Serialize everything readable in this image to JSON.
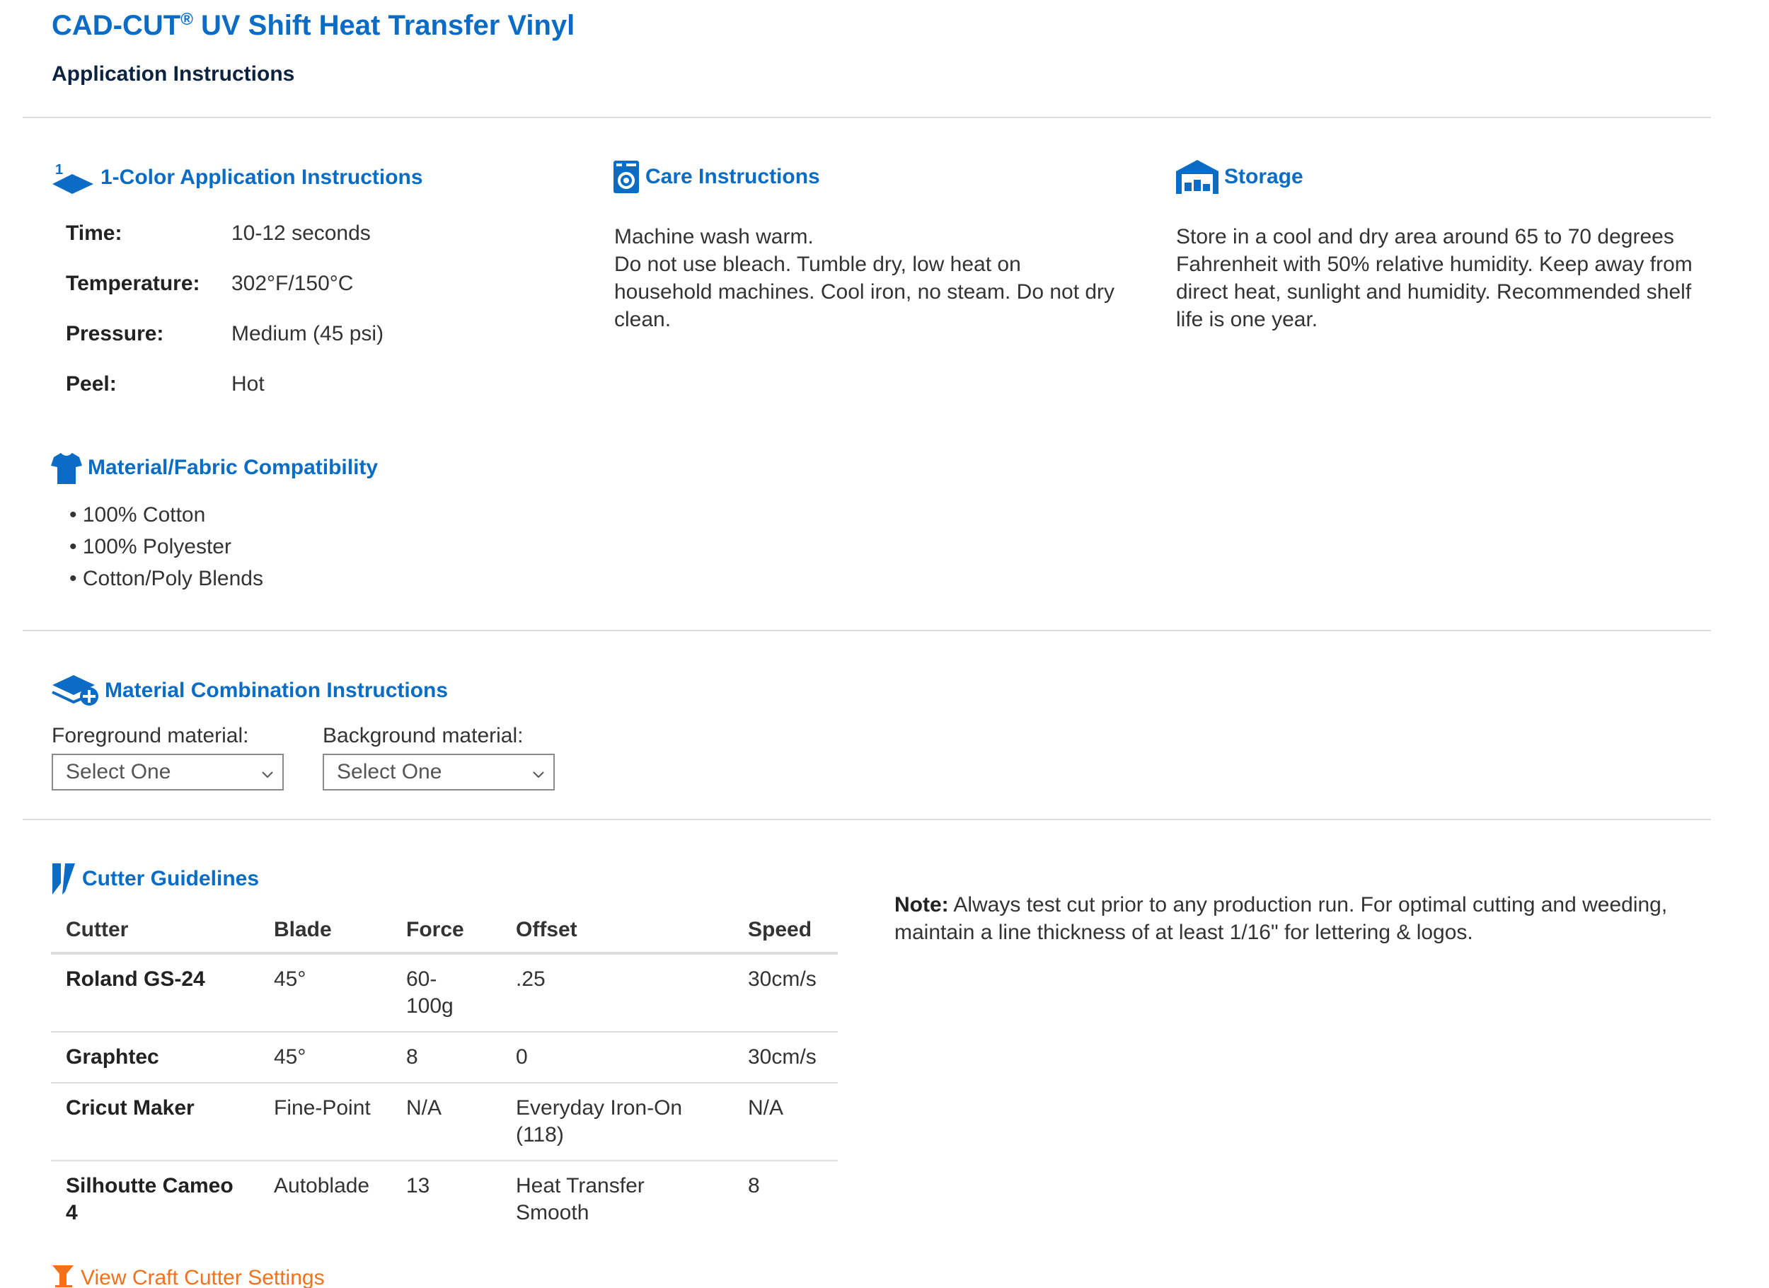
{
  "header": {
    "title_main": "CAD-CUT",
    "title_reg": "®",
    "title_rest": " UV Shift Heat Transfer Vinyl",
    "subtitle": "Application Instructions"
  },
  "application": {
    "heading": "1-Color Application Instructions",
    "icon": "layer-1-icon",
    "rows": [
      {
        "key": "Time:",
        "value": "10-12 seconds"
      },
      {
        "key": "Temperature:",
        "value": "302°F/150°C"
      },
      {
        "key": "Pressure:",
        "value": "Medium (45 psi)"
      },
      {
        "key": "Peel:",
        "value": "Hot"
      }
    ]
  },
  "care": {
    "heading": "Care Instructions",
    "icon": "washing-machine-icon",
    "text": "Machine wash warm.\nDo not use bleach. Tumble dry, low heat on household machines. Cool iron, no steam. Do not dry clean."
  },
  "storage": {
    "heading": "Storage",
    "icon": "warehouse-icon",
    "text": "Store in a cool and dry area around 65 to 70 degrees Fahrenheit with 50% relative humidity. Keep away from direct heat, sunlight and humidity. Recommended shelf life is one year."
  },
  "fabric": {
    "heading": "Material/Fabric Compatibility",
    "icon": "tshirt-icon",
    "items": [
      "• 100% Cotton",
      "• 100% Polyester",
      "• Cotton/Poly Blends"
    ]
  },
  "combination": {
    "heading": "Material Combination Instructions",
    "icon": "layers-plus-icon",
    "foreground_label": "Foreground material:",
    "foreground_value": "Select One",
    "background_label": "Background material:",
    "background_value": "Select One"
  },
  "cutter": {
    "heading": "Cutter Guidelines",
    "icon": "blade-icon",
    "columns": [
      "Cutter",
      "Blade",
      "Force",
      "Offset",
      "Speed"
    ],
    "rows": [
      {
        "cutter": "Roland GS-24",
        "blade": "45°",
        "force": "60-\n100g",
        "offset": ".25",
        "speed": "30cm/s"
      },
      {
        "cutter": "Graphtec",
        "blade": "45°",
        "force": "8",
        "offset": "0",
        "speed": "30cm/s"
      },
      {
        "cutter": "Cricut Maker",
        "blade": "Fine-Point",
        "force": "N/A",
        "offset": "Everyday Iron-On\n(118)",
        "speed": "N/A"
      },
      {
        "cutter": "Silhoutte Cameo\n4",
        "blade": "Autoblade",
        "force": "13",
        "offset": "Heat Transfer\nSmooth",
        "speed": "8"
      }
    ],
    "note_label": "Note:",
    "note_text": " Always test cut prior to any production run. For optimal cutting and weeding, maintain a line thickness of at least 1/16\" for lettering & logos.",
    "craft_link": "View Craft Cutter Settings",
    "craft_icon": "craft-cutter-icon"
  },
  "colors": {
    "accent": "#0a6cc4",
    "heading_dark": "#0b2340",
    "link_orange": "#f2711c"
  }
}
